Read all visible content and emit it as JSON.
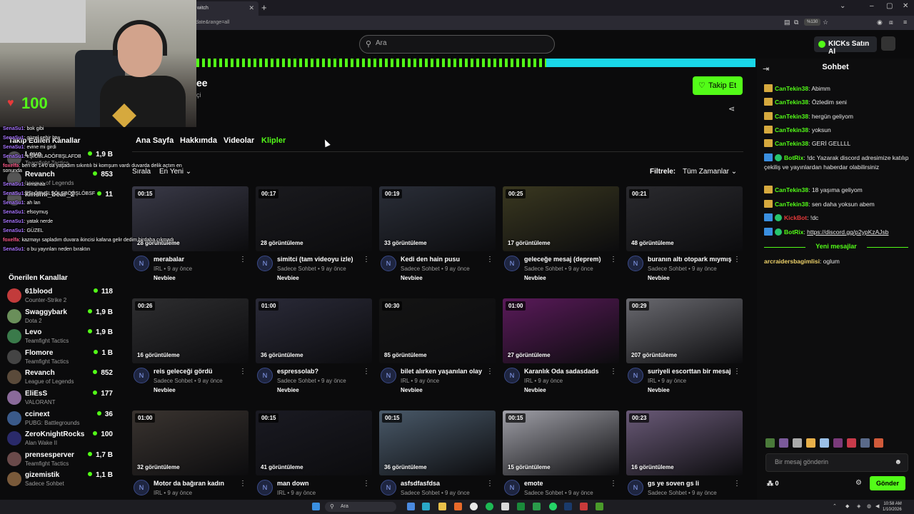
{
  "browser": {
    "tab_title": "witch",
    "url": "date&range=all",
    "zoom": "%130"
  },
  "site": {
    "search_placeholder": "Ara",
    "kicks_button": "KICKs Satın Al"
  },
  "channel": {
    "name": "ee",
    "subtitle": "çi",
    "follow_label": "Takip Et",
    "tabs": [
      "Ana Sayfa",
      "Hakkımda",
      "Videolar",
      "Klipler"
    ],
    "active_tab": "Klipler",
    "sort_label": "Sırala",
    "sort_value": "En Yeni",
    "filter_label": "Filtrele:",
    "filter_value": "Tüm Zamanlar"
  },
  "overlay": {
    "heart_count": "100",
    "messages": [
      {
        "user": "SenaSu1",
        "text": ": bok gibi"
      },
      {
        "user": "SenaSu1",
        "text": ": güzel şehir btw"
      },
      {
        "user": "SenaSu1",
        "text": ": evine mi girdi"
      },
      {
        "user": "SenaSu1",
        "text": ": LŞİÖBLAOÖFBŞLAFDB"
      },
      {
        "user": "foxelfa",
        "text": ": ben de 14'0 da yaşadım sıkıntılı bi komşum vardı duvarda delik açtım en sonunda"
      },
      {
        "user": "SenaSu1",
        "text": ": kinsmaa"
      },
      {
        "user": "SenaSu1",
        "text": ": fŞLÖBVŞLSÖLŞBÖÖŞLÖBSF"
      },
      {
        "user": "SenaSu1",
        "text": ": ah lan"
      },
      {
        "user": "SenaSu1",
        "text": ": efsoymuş"
      },
      {
        "user": "SenaSu1",
        "text": ": yatak nerde"
      },
      {
        "user": "SenaSu1",
        "text": ": GÜZEL"
      },
      {
        "user": "foxelfa",
        "text": ": kazmayı sapladım duvara ikincisi kafana gelir dedim birdaha çıkmadı"
      },
      {
        "user": "SenaSu1",
        "text": ": o bu yayınları neden bıraktın"
      }
    ]
  },
  "sidebar": {
    "followed_title": "Takip Edilen Kanallar",
    "followed": [
      {
        "name": "Levo",
        "game": "Teamfight Tactics",
        "viewers": "1,9 B"
      },
      {
        "name": "Revanch",
        "game": "League of Legends",
        "viewers": "853"
      },
      {
        "name": "kinsmi_bear_2",
        "game": "",
        "viewers": "11"
      }
    ],
    "suggested_title": "Önerilen Kanallar",
    "suggested": [
      {
        "name": "61blood",
        "game": "Counter-Strike 2",
        "viewers": "118",
        "color": "#c23b3b"
      },
      {
        "name": "Swaggybark",
        "game": "Dota 2",
        "viewers": "1,9 B",
        "color": "#6a8f5a"
      },
      {
        "name": "Levo",
        "game": "Teamfight Tactics",
        "viewers": "1,9 B",
        "color": "#3a7a4a"
      },
      {
        "name": "Flomore",
        "game": "Teamfight Tactics",
        "viewers": "1 B",
        "color": "#444444"
      },
      {
        "name": "Revanch",
        "game": "League of Legends",
        "viewers": "852",
        "color": "#5a4a3a"
      },
      {
        "name": "EliEsS",
        "game": "VALORANT",
        "viewers": "177",
        "color": "#8a6a9a"
      },
      {
        "name": "ccinext",
        "game": "PUBG: Battlegrounds",
        "viewers": "36",
        "color": "#3a5a8a"
      },
      {
        "name": "ZeroKnightRocks",
        "game": "Alan Wake II",
        "viewers": "100",
        "color": "#2a2a6a"
      },
      {
        "name": "prensesperver",
        "game": "Teamfight Tactics",
        "viewers": "1,7 B",
        "color": "#6a4a4a"
      },
      {
        "name": "gizemistik",
        "game": "Sadece Sohbet",
        "viewers": "1,1 B",
        "color": "#7a5a3a"
      }
    ]
  },
  "clips": [
    {
      "dur": "00:15",
      "views": "28 görüntüleme",
      "title": "merabalar",
      "cat": "IRL",
      "age": "9 ay önce",
      "user": "Nevbiee",
      "bg": "#3a3a48"
    },
    {
      "dur": "00:17",
      "views": "28 görüntüleme",
      "title": "simitci (tam videoyu izle)",
      "cat": "Sadece Sohbet",
      "age": "9 ay önce",
      "user": "Nevbiee",
      "bg": "#1a1a1e"
    },
    {
      "dur": "00:19",
      "views": "33 görüntüleme",
      "title": "Kedi den hain pusu",
      "cat": "Sadece Sohbet",
      "age": "9 ay önce",
      "user": "Nevbiee",
      "bg": "#2a2e38"
    },
    {
      "dur": "00:25",
      "views": "17 görüntüleme",
      "title": "geleceğe mesaj (deprem)",
      "cat": "Sadece Sohbet",
      "age": "9 ay önce",
      "user": "Nevbiee",
      "bg": "#3a3820"
    },
    {
      "dur": "00:21",
      "views": "48 görüntüleme",
      "title": "buranın altı otopark mıymış",
      "cat": "Sadece Sohbet",
      "age": "9 ay önce",
      "user": "Nevbiee",
      "bg": "#2a2a2e"
    },
    {
      "dur": "00:26",
      "views": "16 görüntüleme",
      "title": "reis geleceği gördü",
      "cat": "Sadece Sohbet",
      "age": "9 ay önce",
      "user": "Nevbiee",
      "bg": "#2e2e30"
    },
    {
      "dur": "01:00",
      "views": "36 görüntüleme",
      "title": "espressolab?",
      "cat": "Sadece Sohbet",
      "age": "9 ay önce",
      "user": "Nevbiee",
      "bg": "#2a2a38"
    },
    {
      "dur": "00:30",
      "views": "85 görüntüleme",
      "title": "bilet alırken yaşanılan olay",
      "cat": "IRL",
      "age": "9 ay önce",
      "user": "Nevbiee",
      "bg": "#141414"
    },
    {
      "dur": "01:00",
      "views": "27 görüntüleme",
      "title": "Karanlık Oda sadasdads",
      "cat": "IRL",
      "age": "9 ay önce",
      "user": "Nevbiee",
      "bg": "#5a1a5a"
    },
    {
      "dur": "00:29",
      "views": "207 görüntüleme",
      "title": "suriyeli escorttan bir mesaj",
      "cat": "IRL",
      "age": "9 ay önce",
      "user": "Nevbiee",
      "bg": "#6a6a70"
    },
    {
      "dur": "01:00",
      "views": "32 görüntüleme",
      "title": "Motor da bağıran kadın",
      "cat": "IRL",
      "age": "9 ay önce",
      "user": "",
      "bg": "#3a3430"
    },
    {
      "dur": "00:15",
      "views": "41 görüntüleme",
      "title": "man down",
      "cat": "IRL",
      "age": "9 ay önce",
      "user": "",
      "bg": "#1a1a22"
    },
    {
      "dur": "00:15",
      "views": "36 görüntüleme",
      "title": "asfsdfasfdsa",
      "cat": "Sadece Sohbet",
      "age": "9 ay önce",
      "user": "",
      "bg": "#4a5a6a"
    },
    {
      "dur": "00:15",
      "views": "15 görüntüleme",
      "title": "emote",
      "cat": "Sadece Sohbet",
      "age": "9 ay önce",
      "user": "",
      "bg": "#a0a0a8"
    },
    {
      "dur": "00:23",
      "views": "16 görüntüleme",
      "title": "gs ye soven gs li",
      "cat": "Sadece Sohbet",
      "age": "9 ay önce",
      "user": "",
      "bg": "#6a5a78"
    }
  ],
  "chat": {
    "title": "Sohbet",
    "messages": [
      {
        "user": "CanTekin38",
        "text": ": Abimm",
        "badge": "gold"
      },
      {
        "user": "CanTekin38",
        "text": ": Özledim seni",
        "badge": "gold"
      },
      {
        "user": "CanTekin38",
        "text": ": hergün geliyom",
        "badge": "gold"
      },
      {
        "user": "CanTekin38",
        "text": ": yoksun",
        "badge": "gold"
      },
      {
        "user": "CanTekin38",
        "text": ": GERİ GELLLL",
        "badge": "gold"
      },
      {
        "user": "BotRix",
        "text": ": !dc Yazarak discord adresimize katılıp çekiliş ve yayınlardan haberdar olabilirsiniz",
        "badge": "bot"
      },
      {
        "user": "CanTekin38",
        "text": ": 18 yaşıma geliyom",
        "badge": "gold"
      },
      {
        "user": "CanTekin38",
        "text": ": sen daha yoksun abem",
        "badge": "gold"
      },
      {
        "user": "KickBot",
        "text": ": !dc",
        "badge": "bot"
      },
      {
        "user": "BotRix",
        "text": ": https://discord.gg/p2ypKzAJsb",
        "badge": "bot"
      }
    ],
    "new_messages_label": "Yeni mesajlar",
    "new_message": {
      "user": "arcraidersbagimlisi",
      "text": ": oglum"
    },
    "input_placeholder": "Bir mesaj gönderin",
    "points": "0",
    "send_label": "Gönder"
  },
  "taskbar": {
    "search_placeholder": "Ara",
    "time": "10:58 AM",
    "date": "1/10/2026"
  },
  "colors": {
    "accent": "#53fc18"
  }
}
